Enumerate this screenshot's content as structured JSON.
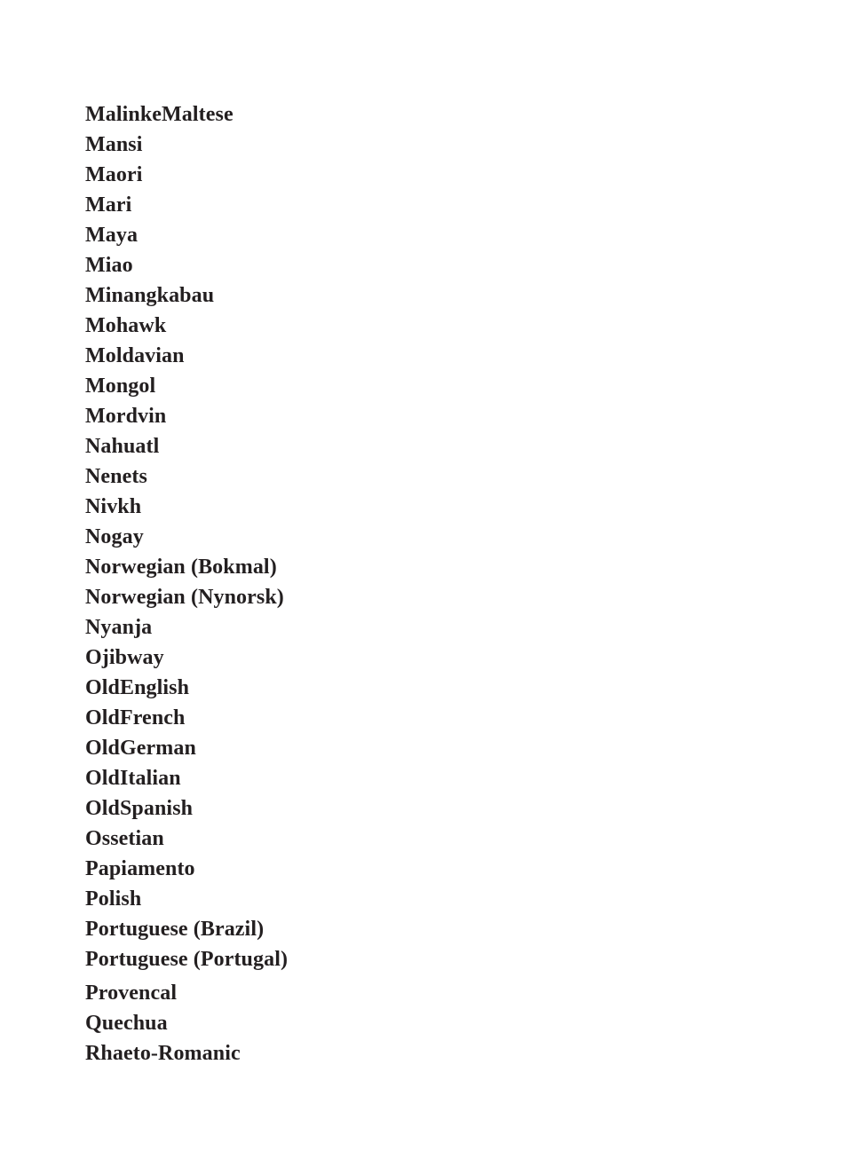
{
  "document": {
    "background_color": "#ffffff",
    "text_color": "#231f20",
    "list": {
      "label": "language-list",
      "items": [
        {
          "label": "MalinkeMaltese",
          "extra_space_before": false
        },
        {
          "label": "Mansi",
          "extra_space_before": false
        },
        {
          "label": "Maori",
          "extra_space_before": false
        },
        {
          "label": "Mari",
          "extra_space_before": false
        },
        {
          "label": "Maya",
          "extra_space_before": false
        },
        {
          "label": "Miao",
          "extra_space_before": false
        },
        {
          "label": "Minangkabau",
          "extra_space_before": false
        },
        {
          "label": "Mohawk",
          "extra_space_before": false
        },
        {
          "label": "Moldavian",
          "extra_space_before": false
        },
        {
          "label": "Mongol",
          "extra_space_before": false
        },
        {
          "label": "Mordvin",
          "extra_space_before": false
        },
        {
          "label": "Nahuatl",
          "extra_space_before": false
        },
        {
          "label": "Nenets",
          "extra_space_before": false
        },
        {
          "label": "Nivkh",
          "extra_space_before": false
        },
        {
          "label": "Nogay",
          "extra_space_before": false
        },
        {
          "label": "Norwegian (Bokmal)",
          "extra_space_before": false
        },
        {
          "label": "Norwegian (Nynorsk)",
          "extra_space_before": false
        },
        {
          "label": "Nyanja",
          "extra_space_before": false
        },
        {
          "label": "Ojibway",
          "extra_space_before": false
        },
        {
          "label": "OldEnglish",
          "extra_space_before": false
        },
        {
          "label": "OldFrench",
          "extra_space_before": false
        },
        {
          "label": "OldGerman",
          "extra_space_before": false
        },
        {
          "label": "OldItalian",
          "extra_space_before": false
        },
        {
          "label": "OldSpanish",
          "extra_space_before": false
        },
        {
          "label": "Ossetian",
          "extra_space_before": false
        },
        {
          "label": "Papiamento",
          "extra_space_before": false
        },
        {
          "label": "Polish",
          "extra_space_before": false
        },
        {
          "label": "Portuguese (Brazil)",
          "extra_space_before": false
        },
        {
          "label": "Portuguese (Portugal)",
          "extra_space_before": false
        },
        {
          "label": "Provencal",
          "extra_space_before": true
        },
        {
          "label": "Quechua",
          "extra_space_before": false
        },
        {
          "label": "Rhaeto-Romanic",
          "extra_space_before": false
        }
      ]
    }
  }
}
